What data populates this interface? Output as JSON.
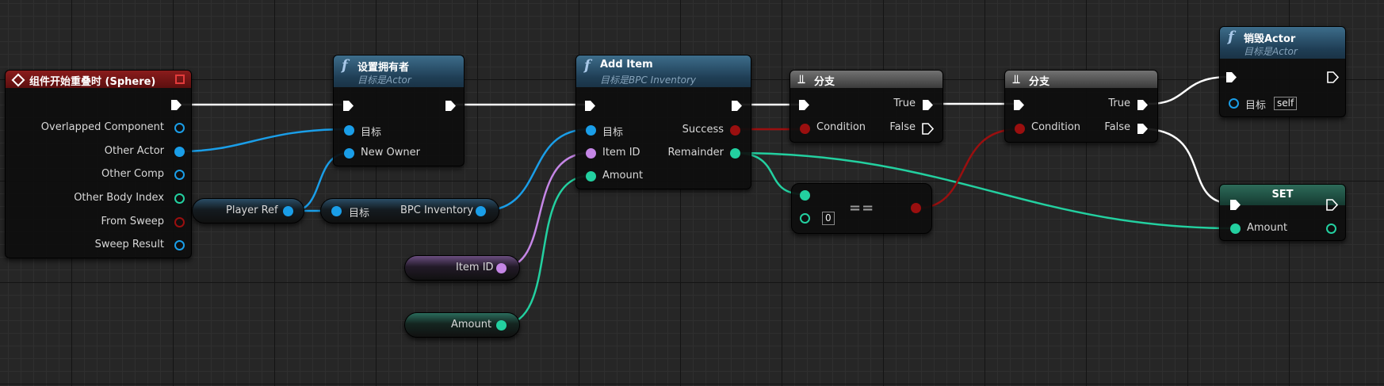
{
  "event_node": {
    "title": "组件开始重叠时 (Sphere)",
    "pins": [
      "Overlapped Component",
      "Other Actor",
      "Other Comp",
      "Other Body Index",
      "From Sweep",
      "Sweep Result"
    ]
  },
  "set_owner_node": {
    "title": "设置拥有者",
    "subtitle": "目标是Actor",
    "pin_target": "目标",
    "pin_new_owner": "New Owner"
  },
  "player_ref_node": {
    "label": "Player Ref"
  },
  "bpc_inventory_node": {
    "pin_target": "目标",
    "output": "BPC Inventory"
  },
  "add_item_node": {
    "title": "Add Item",
    "subtitle": "目标是BPC Inventory",
    "inputs": [
      "目标",
      "Item ID",
      "Amount"
    ],
    "outputs": [
      "Success",
      "Remainder"
    ]
  },
  "item_id_var": {
    "label": "Item ID"
  },
  "amount_var": {
    "label": "Amount"
  },
  "branch1": {
    "title": "分支",
    "true_label": "True",
    "false_label": "False",
    "condition_label": "Condition"
  },
  "branch2": {
    "title": "分支",
    "true_label": "True",
    "false_label": "False",
    "condition_label": "Condition"
  },
  "equals_node": {
    "literal": "0",
    "operator": "=="
  },
  "destroy_node": {
    "title": "销毁Actor",
    "subtitle": "目标是Actor",
    "pin_target": "目标",
    "target_value": "self"
  },
  "set_node": {
    "title": "SET",
    "pin_amount": "Amount"
  },
  "colors": {
    "background": "#262626",
    "exec_wire": "#ffffff",
    "object_pin": "#1a9ee8",
    "int_pin": "#23d0a0",
    "bool_pin": "#9a0f0f",
    "name_pin": "#c586e6",
    "function_header": "#2b5470",
    "event_header": "#7a1818"
  }
}
